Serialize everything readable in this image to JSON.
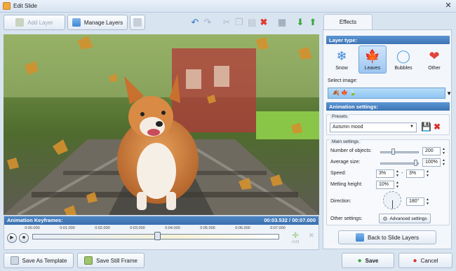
{
  "window": {
    "title": "Edit Slide",
    "close_glyph": "✕"
  },
  "toolbar": {
    "add_layer_label": "Add Layer",
    "manage_layers_label": "Manage Layers"
  },
  "keyframes": {
    "title": "Animation Keyframes:",
    "time": "00:03.532 / 00:07.000",
    "ruler": [
      "0:00.000",
      "0:01.000",
      "0:02.000",
      "0:03.000",
      "0:04.000",
      "0:05.000",
      "0:06.000",
      "0:07.000"
    ],
    "playhead_fraction": 0.505,
    "add_label": "Add"
  },
  "bottom": {
    "save_template_label": "Save As Template",
    "save_still_label": "Save Still Frame",
    "save_label": "Save",
    "cancel_label": "Cancel"
  },
  "panel": {
    "tab_label": "Effects",
    "layer_type_title": "Layer type:",
    "layer_types": [
      {
        "label": "Snow",
        "icon": "snowflake-icon",
        "glyph": "❄",
        "color": "#3b86d8",
        "selected": false
      },
      {
        "label": "Leaves",
        "icon": "leaf-icon",
        "glyph": "🍁",
        "color": "#e5a21a",
        "selected": true
      },
      {
        "label": "Bubbles",
        "icon": "bubble-icon",
        "glyph": "◯",
        "color": "#5aa7e6",
        "selected": false
      },
      {
        "label": "Other",
        "icon": "hearts-icon",
        "glyph": "❤",
        "color": "#e0443a",
        "selected": false
      }
    ],
    "select_image_label": "Select image:",
    "animation_settings_title": "Animation settings:",
    "presets_caption": "Presets",
    "preset_value": "Autumn mood",
    "main_settings_caption": "Main settings",
    "number_of_objects_label": "Number of objects:",
    "number_of_objects_value": "200",
    "average_size_label": "Average size:",
    "average_size_value": "100%",
    "speed_label": "Speed:",
    "speed_min": "3%",
    "speed_dash": "-",
    "speed_max": "3%",
    "melting_height_label": "Melting height:",
    "melting_height_value": "10%",
    "direction_label": "Direction:",
    "direction_value": "180°",
    "other_settings_label": "Other settings:",
    "advanced_settings_label": "Advanced settings",
    "back_label": "Back to Slide Layers"
  },
  "colors": {
    "accent": "#3d74b5",
    "save_green": "#3aa83a",
    "cancel_red": "#d9332b"
  }
}
